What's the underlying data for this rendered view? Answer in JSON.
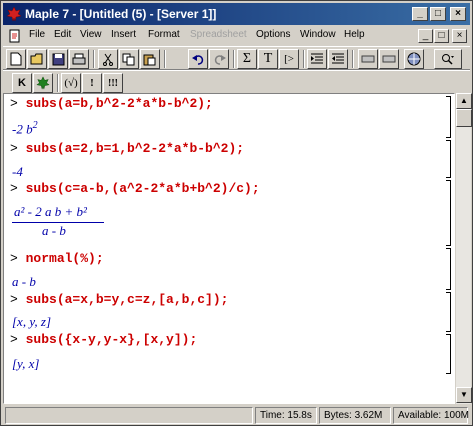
{
  "window": {
    "title": "Maple 7 - [Untitled (5) - [Server 1]]",
    "controls": [
      "_",
      "□",
      "×"
    ]
  },
  "menu": {
    "items": [
      "File",
      "Edit",
      "View",
      "Insert",
      "Format",
      "Spreadsheet",
      "Options",
      "Window",
      "Help"
    ],
    "disabled": [
      "Spreadsheet"
    ],
    "mdi_controls": [
      "_",
      "□",
      "×"
    ]
  },
  "toolbar1": {
    "tools": [
      "new-icon",
      "open-icon",
      "save-icon",
      "print-icon",
      "cut-icon",
      "copy-icon",
      "paste-icon",
      "undo-icon",
      "redo-icon",
      "sigma-icon",
      "text-icon",
      "prompt-icon",
      "indent-icon",
      "outdent-icon",
      "stop-icon",
      "zoom-icon",
      "restart-icon",
      "magnify-icon"
    ],
    "labels": {
      "sigma": "Σ",
      "text": "T",
      "prompt": "[>"
    }
  },
  "toolbar2": {
    "tools": [
      "K",
      "leaf",
      "(√)",
      "!",
      "!!!"
    ]
  },
  "worksheet": {
    "lines": [
      {
        "type": "input",
        "prompt": ">",
        "text": "subs(a=b,b^2-2*a*b-b^2);"
      },
      {
        "type": "output",
        "text": "-2 b",
        "sup": "2"
      },
      {
        "type": "input",
        "prompt": ">",
        "text": "subs(a=2,b=1,b^2-2*a*b-b^2);"
      },
      {
        "type": "output",
        "text": "-4"
      },
      {
        "type": "input",
        "prompt": ">",
        "text": "subs(c=a-b,(a^2-2*a*b+b^2)/c);"
      },
      {
        "type": "fraction",
        "numerator": "a² - 2 a b + b²",
        "denominator": "a - b"
      },
      {
        "type": "input",
        "prompt": ">",
        "text": "normal(%);"
      },
      {
        "type": "output",
        "text": "a - b"
      },
      {
        "type": "input",
        "prompt": ">",
        "text": "subs(a=x,b=y,c=z,[a,b,c]);"
      },
      {
        "type": "output",
        "text": "[x, y, z]"
      },
      {
        "type": "input",
        "prompt": ">",
        "text": "subs({x-y,y-x},[x,y]);"
      },
      {
        "type": "output",
        "text": "[y, x]"
      }
    ]
  },
  "status": {
    "time": "Time: 15.8s",
    "bytes": "Bytes: 3.62M",
    "available": "Available: 100M"
  },
  "colors": {
    "title_start": "#0a246a",
    "title_end": "#3a6ea5",
    "input_text": "#cc0000",
    "output_text": "#0000aa"
  }
}
